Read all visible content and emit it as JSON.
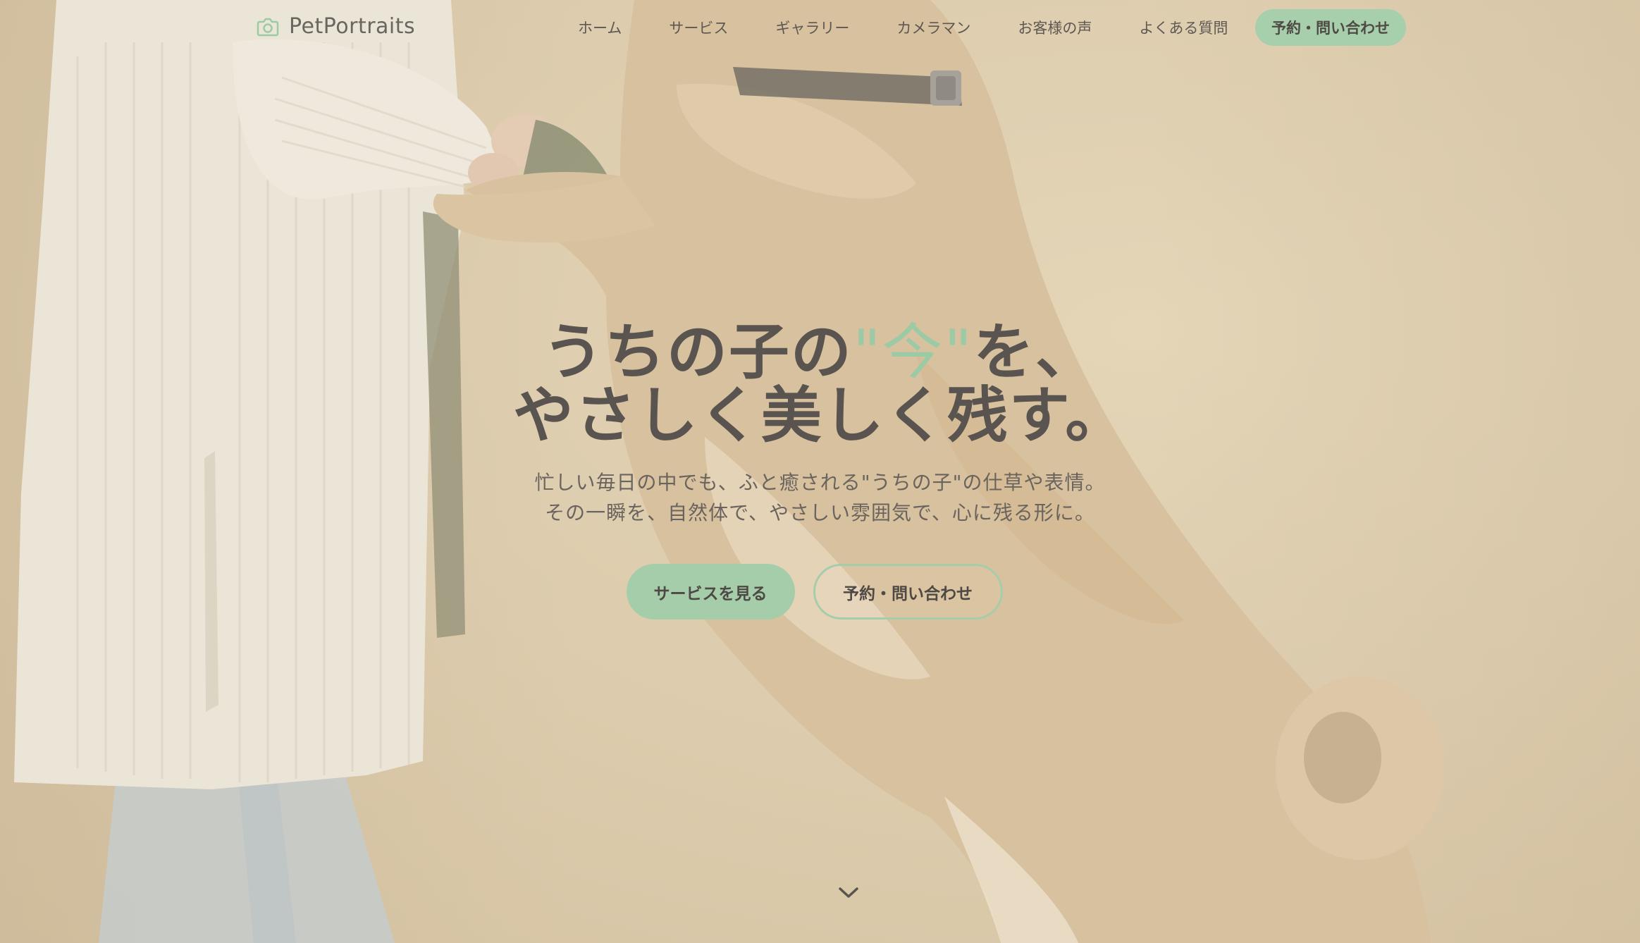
{
  "logo": {
    "icon": "camera-icon",
    "text": "PetPortraits"
  },
  "nav": {
    "items": [
      {
        "label": "ホーム"
      },
      {
        "label": "サービス"
      },
      {
        "label": "ギャラリー"
      },
      {
        "label": "カメラマン"
      },
      {
        "label": "お客様の声"
      },
      {
        "label": "よくある質問"
      }
    ],
    "cta_label": "予約・問い合わせ"
  },
  "hero": {
    "title_line1_pre": "うちの子の",
    "title_accent": "\"今\"",
    "title_line1_post": "を、",
    "title_line2": "やさしく美しく残す。",
    "subtitle_line1": "忙しい毎日の中でも、ふと癒される\"うちの子\"の仕草や表情。",
    "subtitle_line2": "その一瞬を、自然体で、やさしい雰囲気で、心に残る形に。",
    "primary_button": "サービスを見る",
    "secondary_button": "予約・問い合わせ",
    "scroll_icon": "chevron-down-icon"
  },
  "colors": {
    "accent": "#a5cdaa",
    "text": "#5a5450",
    "background": "#d6c3a2"
  }
}
